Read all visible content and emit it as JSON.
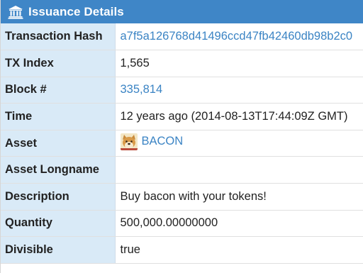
{
  "header": {
    "title": "Issuance Details",
    "icon": "bank-icon",
    "color": "#3f86c7"
  },
  "rows": [
    {
      "label": "Transaction Hash",
      "value": "a7f5a126768d41496ccd47fb42460db98b2c0",
      "link": true
    },
    {
      "label": "TX Index",
      "value": "1,565",
      "link": false
    },
    {
      "label": "Block #",
      "value": "335,814",
      "link": true
    },
    {
      "label": "Time",
      "value": "12 years ago (2014-08-13T17:44:09Z GMT)",
      "link": false
    },
    {
      "label": "Asset",
      "value": "BACON",
      "link": true,
      "icon": "doge-icon"
    },
    {
      "label": "Asset Longname",
      "value": "",
      "link": false
    },
    {
      "label": "Description",
      "value": "Buy bacon with your tokens!",
      "link": false
    },
    {
      "label": "Quantity",
      "value": "500,000.00000000",
      "link": false
    },
    {
      "label": "Divisible",
      "value": "true",
      "link": false
    }
  ],
  "colors": {
    "label_bg": "#d9eaf7",
    "link": "#3b84c4"
  }
}
